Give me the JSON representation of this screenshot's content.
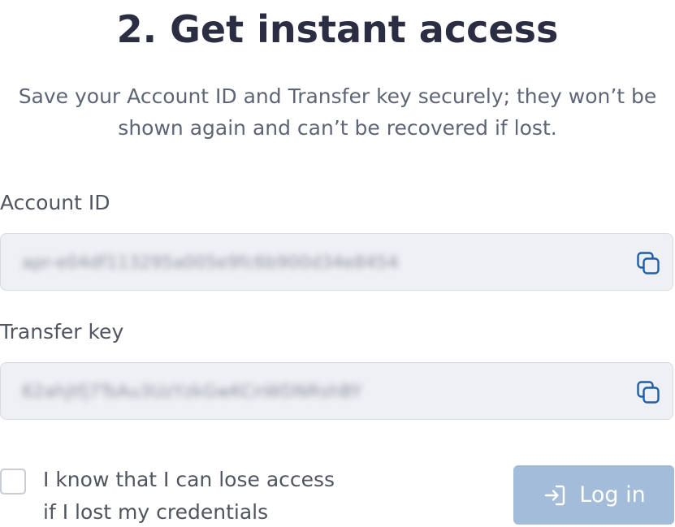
{
  "title": "2. Get instant access",
  "subtitle": "Save your Account ID and Transfer key securely; they won’t be shown again and can’t be recovered if lost.",
  "account_id": {
    "label": "Account ID",
    "value": "apr-e04df113295a005e9fc6b900d34e8454",
    "copy_icon": "copy-icon"
  },
  "transfer_key": {
    "label": "Transfer key",
    "value": "62ahjtfj7TsAu3UzYzkGwKCnWDNRshBY",
    "copy_icon": "copy-icon"
  },
  "confirm": {
    "label_line1": "I know that I can lose access",
    "label_line2": "if I lost my credentials",
    "checked": false
  },
  "login": {
    "label": "Log in",
    "icon": "login-icon"
  },
  "colors": {
    "title": "#2b2d42",
    "text": "#50555f",
    "field_bg": "#eef0f4",
    "copy_icon": "#1f5fa8",
    "login_bg": "#a3bcd9"
  }
}
